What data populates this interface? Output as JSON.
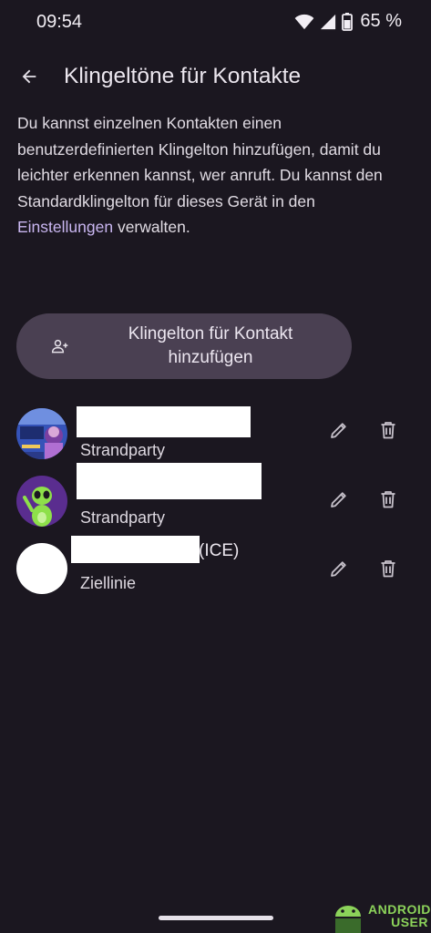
{
  "status_bar": {
    "time": "09:54",
    "battery": "65 %"
  },
  "app_bar": {
    "title": "Klingeltöne für Kontakte"
  },
  "description": {
    "text": "Du kannst einzelnen Kontakten einen benutzerdefinierten Klingelton hinzufügen, damit du leichter erkennen kannst, wer anruft. Du kannst den Standardklingelton für dieses Gerät in den ",
    "link": "Einstellungen",
    "suffix": " verwalten."
  },
  "add_button": {
    "label_line1": "Klingelton für Kontakt",
    "label_line2": "hinzufügen"
  },
  "contacts": [
    {
      "ringtone": "Strandparty",
      "name_suffix": ""
    },
    {
      "ringtone": "Strandparty",
      "name_suffix": ""
    },
    {
      "ringtone": "Ziellinie",
      "name_suffix": "(ICE)"
    }
  ],
  "icons": {
    "back": "arrow-back-icon",
    "add_person": "person-add-icon",
    "edit": "pencil-icon",
    "delete": "trash-icon",
    "wifi": "wifi-icon",
    "signal": "signal-icon",
    "battery": "battery-icon"
  },
  "watermark": {
    "line1": "ANDROID",
    "line2": "USER"
  },
  "colors": {
    "background": "#1b1720",
    "button": "#4a4052",
    "link": "#c9b6f0",
    "watermark": "#8cd35a"
  }
}
